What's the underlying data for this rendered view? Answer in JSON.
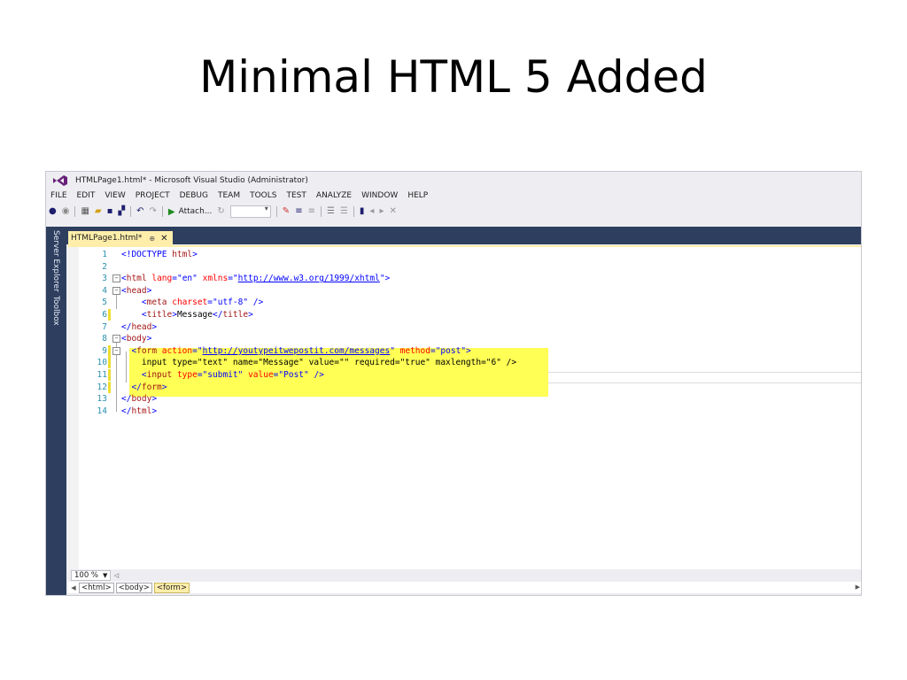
{
  "slide": {
    "title": "Minimal HTML 5 Added"
  },
  "window": {
    "title": "HTMLPage1.html* - Microsoft Visual Studio (Administrator)"
  },
  "menu": [
    "FILE",
    "EDIT",
    "VIEW",
    "PROJECT",
    "DEBUG",
    "TEAM",
    "TOOLS",
    "TEST",
    "ANALYZE",
    "WINDOW",
    "HELP"
  ],
  "toolbar": {
    "attach_label": "Attach..."
  },
  "side_tabs": {
    "server_explorer": "Server Explorer",
    "toolbox": "Toolbox"
  },
  "doc_tab": {
    "name": "HTMLPage1.html*",
    "pin": "⊕",
    "close": "✕"
  },
  "code": {
    "lines": [
      {
        "n": "1",
        "parts": [
          [
            "t-br",
            "<!DOCTYPE "
          ],
          [
            "t-tag",
            "html"
          ],
          [
            "t-br",
            ">"
          ]
        ]
      },
      {
        "n": "2",
        "parts": []
      },
      {
        "n": "3",
        "parts": [
          [
            "t-br",
            "<"
          ],
          [
            "t-tag",
            "html "
          ],
          [
            "t-attr",
            "lang"
          ],
          [
            "t-br",
            "=\""
          ],
          [
            "t-val",
            "en"
          ],
          [
            "t-br",
            "\" "
          ],
          [
            "t-attr",
            "xmlns"
          ],
          [
            "t-br",
            "=\""
          ],
          [
            "t-url",
            "http://www.w3.org/1999/xhtml"
          ],
          [
            "t-br",
            "\">"
          ]
        ]
      },
      {
        "n": "4",
        "parts": [
          [
            "t-br",
            "<"
          ],
          [
            "t-tag",
            "head"
          ],
          [
            "t-br",
            ">"
          ]
        ]
      },
      {
        "n": "5",
        "parts": [
          [
            "t-br",
            "    <"
          ],
          [
            "t-tag",
            "meta "
          ],
          [
            "t-attr",
            "charset"
          ],
          [
            "t-br",
            "=\""
          ],
          [
            "t-val",
            "utf-8"
          ],
          [
            "t-br",
            "\" />"
          ]
        ]
      },
      {
        "n": "6",
        "parts": [
          [
            "t-br",
            "    <"
          ],
          [
            "t-tag",
            "title"
          ],
          [
            "t-br",
            ">"
          ],
          [
            "t-txt",
            "Message"
          ],
          [
            "t-br",
            "</"
          ],
          [
            "t-tag",
            "title"
          ],
          [
            "t-br",
            ">"
          ]
        ]
      },
      {
        "n": "7",
        "parts": [
          [
            "t-br",
            "</"
          ],
          [
            "t-tag",
            "head"
          ],
          [
            "t-br",
            ">"
          ]
        ]
      },
      {
        "n": "8",
        "parts": [
          [
            "t-br",
            "<"
          ],
          [
            "t-tag",
            "body"
          ],
          [
            "t-br",
            ">"
          ]
        ]
      },
      {
        "n": "9",
        "parts": [
          [
            "t-br",
            "  <"
          ],
          [
            "t-tag",
            "form "
          ],
          [
            "t-attr",
            "action"
          ],
          [
            "t-br",
            "=\""
          ],
          [
            "t-url",
            "http://youtypeitwepostit.com/messages"
          ],
          [
            "t-br",
            "\" "
          ],
          [
            "t-attr",
            "method"
          ],
          [
            "t-br",
            "=\""
          ],
          [
            "t-val",
            "post"
          ],
          [
            "t-br",
            "\">"
          ]
        ]
      },
      {
        "n": "10",
        "parts": [
          [
            "t-txt",
            "    input type=\"text\" name=\"Message\" value=\"\" required=\"true\" maxlength=\"6\" />"
          ]
        ]
      },
      {
        "n": "11",
        "parts": [
          [
            "t-br",
            "    <"
          ],
          [
            "t-tag",
            "input "
          ],
          [
            "t-attr",
            "type"
          ],
          [
            "t-br",
            "=\""
          ],
          [
            "t-val",
            "submit"
          ],
          [
            "t-br",
            "\" "
          ],
          [
            "t-attr",
            "value"
          ],
          [
            "t-br",
            "=\""
          ],
          [
            "t-val",
            "Post"
          ],
          [
            "t-br",
            "\" />"
          ]
        ]
      },
      {
        "n": "12",
        "parts": [
          [
            "t-br",
            "  </"
          ],
          [
            "t-tag",
            "form"
          ],
          [
            "t-br",
            ">"
          ]
        ]
      },
      {
        "n": "13",
        "parts": [
          [
            "t-br",
            "</"
          ],
          [
            "t-tag",
            "body"
          ],
          [
            "t-br",
            ">"
          ]
        ]
      },
      {
        "n": "14",
        "parts": [
          [
            "t-br",
            "</"
          ],
          [
            "t-tag",
            "html"
          ],
          [
            "t-br",
            ">"
          ]
        ]
      }
    ]
  },
  "status": {
    "zoom": "100 %"
  },
  "breadcrumbs": [
    "<html>",
    "<body>",
    "<form>"
  ],
  "colors": {
    "highlight": "#ffff55",
    "side_panel": "#2d3e5f",
    "tab_active": "#ffeeaa"
  }
}
